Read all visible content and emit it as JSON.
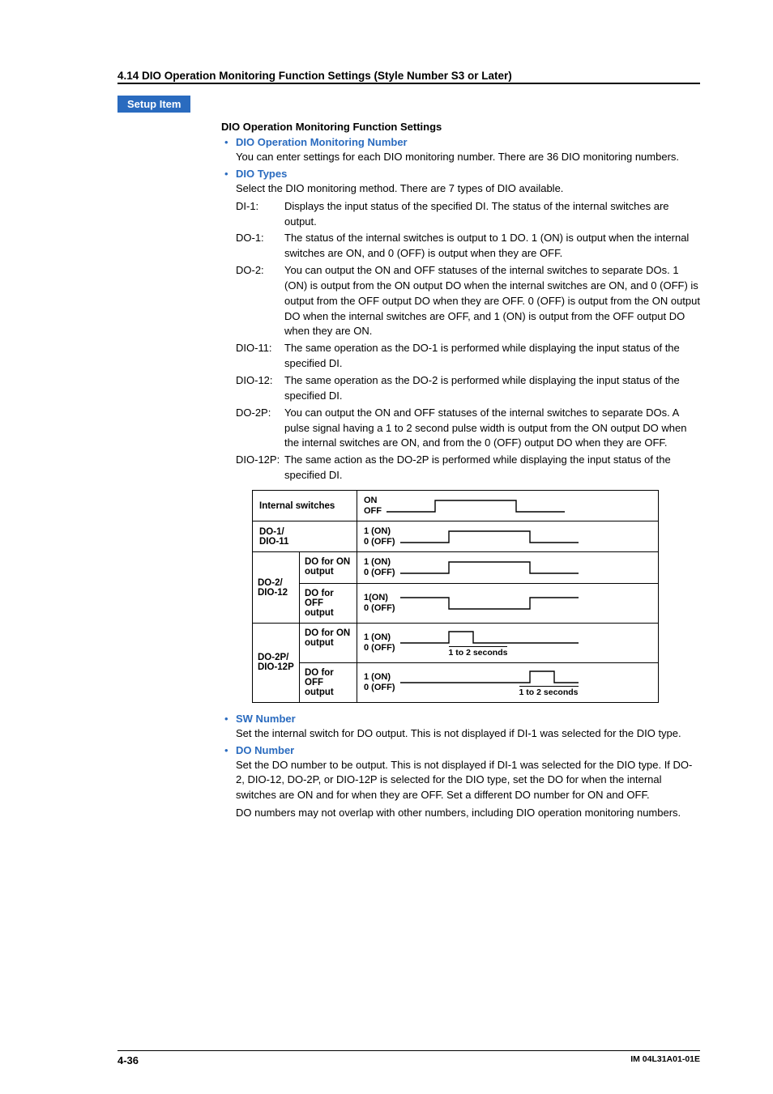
{
  "section_header": "4.14 DIO Operation Monitoring Function Settings (Style Number S3 or Later)",
  "setup_badge": "Setup Item",
  "main_heading": "DIO Operation Monitoring Function Settings",
  "bullets_top": {
    "dio_number": {
      "title": "DIO Operation Monitoring Number",
      "body": "You can enter settings for each DIO monitoring number.  There are 36 DIO monitoring numbers."
    },
    "dio_types": {
      "title": "DIO Types",
      "intro": "Select the DIO monitoring method.  There are 7 types of DIO available.",
      "items": [
        {
          "term": "DI-1:",
          "desc": "Displays the input status of the specified DI.  The status of the internal switches are output."
        },
        {
          "term": "DO-1:",
          "desc": "The status of the internal switches is output to 1 DO.  1 (ON) is output when the internal switches are ON, and 0 (OFF) is output when they are OFF."
        },
        {
          "term": "DO-2:",
          "desc": "You can output the ON and OFF statuses of the internal switches to separate DOs.  1 (ON) is output from the ON output DO when the internal switches are ON, and 0 (OFF) is output from the OFF output DO when they are OFF.  0 (OFF) is output from the ON output DO when the internal switches are OFF, and 1 (ON) is output from the OFF output DO when they are ON."
        },
        {
          "term": "DIO-11:",
          "desc": "The same operation as the DO-1 is performed while displaying the input status of the specified DI."
        },
        {
          "term": "DIO-12:",
          "desc": "The same operation as the DO-2 is performed while displaying the input status of the specified DI."
        },
        {
          "term": "DO-2P:",
          "desc": "You can output the ON and OFF statuses of the internal switches to separate DOs.  A pulse signal having a 1 to 2 second pulse width is output from the ON output DO when the internal switches are ON, and from the 0 (OFF) output DO when they are OFF."
        },
        {
          "term": "DIO-12P:",
          "desc": "The same action as the DO-2P is performed while displaying the input status of the specified DI."
        }
      ]
    }
  },
  "wave_table": {
    "rows": [
      {
        "label": "Internal switches",
        "high": "ON",
        "low": "OFF"
      },
      {
        "label": "DO-1/\nDIO-11",
        "high": "1 (ON)",
        "low": "0 (OFF)"
      }
    ],
    "group1": {
      "label": "DO-2/\nDIO-12",
      "sub": [
        {
          "mid": "DO for ON output",
          "high": "1 (ON)",
          "low": "0 (OFF)"
        },
        {
          "mid": "DO for OFF output",
          "high": "1(ON)",
          "low": "0 (OFF)"
        }
      ]
    },
    "group2": {
      "label": "DO-2P/\nDIO-12P",
      "sub": [
        {
          "mid": "DO for ON output",
          "high": "1 (ON)",
          "low": "0 (OFF)",
          "tag": "1 to 2 seconds"
        },
        {
          "mid": "DO for OFF output",
          "high": "1 (ON)",
          "low": "0 (OFF)",
          "tag": "1 to 2 seconds"
        }
      ]
    }
  },
  "bullets_bottom": {
    "sw_number": {
      "title": "SW Number",
      "body": "Set the internal switch for DO output.  This is not displayed if DI-1 was selected for the DIO type."
    },
    "do_number": {
      "title": "DO Number",
      "body1": "Set the DO number to be output.  This is not displayed if DI-1 was selected for the DIO type.  If DO-2, DIO-12, DO-2P, or DIO-12P is selected for the DIO type, set the DO for when the internal switches are ON and for when they are OFF.  Set a different DO number for ON and OFF.",
      "body2": "DO numbers may not overlap with other numbers, including DIO operation monitoring numbers."
    }
  },
  "footer": {
    "page": "4-36",
    "doc": "IM 04L31A01-01E"
  }
}
